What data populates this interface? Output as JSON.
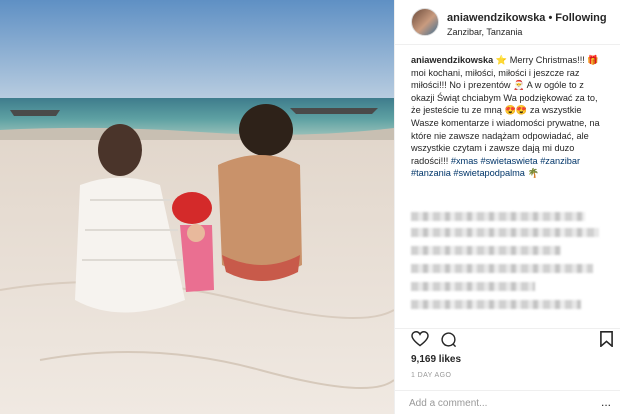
{
  "post": {
    "username": "aniawendzikowska",
    "follow_status": "Following",
    "location": "Zanzibar, Tanzania",
    "caption_user": "aniawendzikowska",
    "caption_text": "⭐ Merry Christmas!!! 🎁 moi kochani, miłości, miłości i jeszcze raz miłości!!! No i prezentów 🎅 A w ogóle to z okazji Świąt chciabym Wa podziękować za to, że jesteście tu ze mną 😍😍 za wszystkie Wasze komentarze i wiadomości prywatne, na które nie zawsze nadążam odpowiadać, ale wszystkie czytam i zawsze dają mi duzo radości!!!",
    "hashtags": "#xmas #swietaswieta #zanzibar #tanzania #swietapodpalma 🌴",
    "likes": "9,169 likes",
    "time_ago": "1 DAY AGO",
    "comment_placeholder": "Add a comment...",
    "more_label": "..."
  },
  "icons": {
    "like": "heart-icon",
    "comment": "speech-bubble-icon",
    "save": "bookmark-icon",
    "options": "more-options-icon"
  },
  "colors": {
    "link": "#003569",
    "text": "#262626",
    "muted": "#999999",
    "border": "#efefef"
  }
}
